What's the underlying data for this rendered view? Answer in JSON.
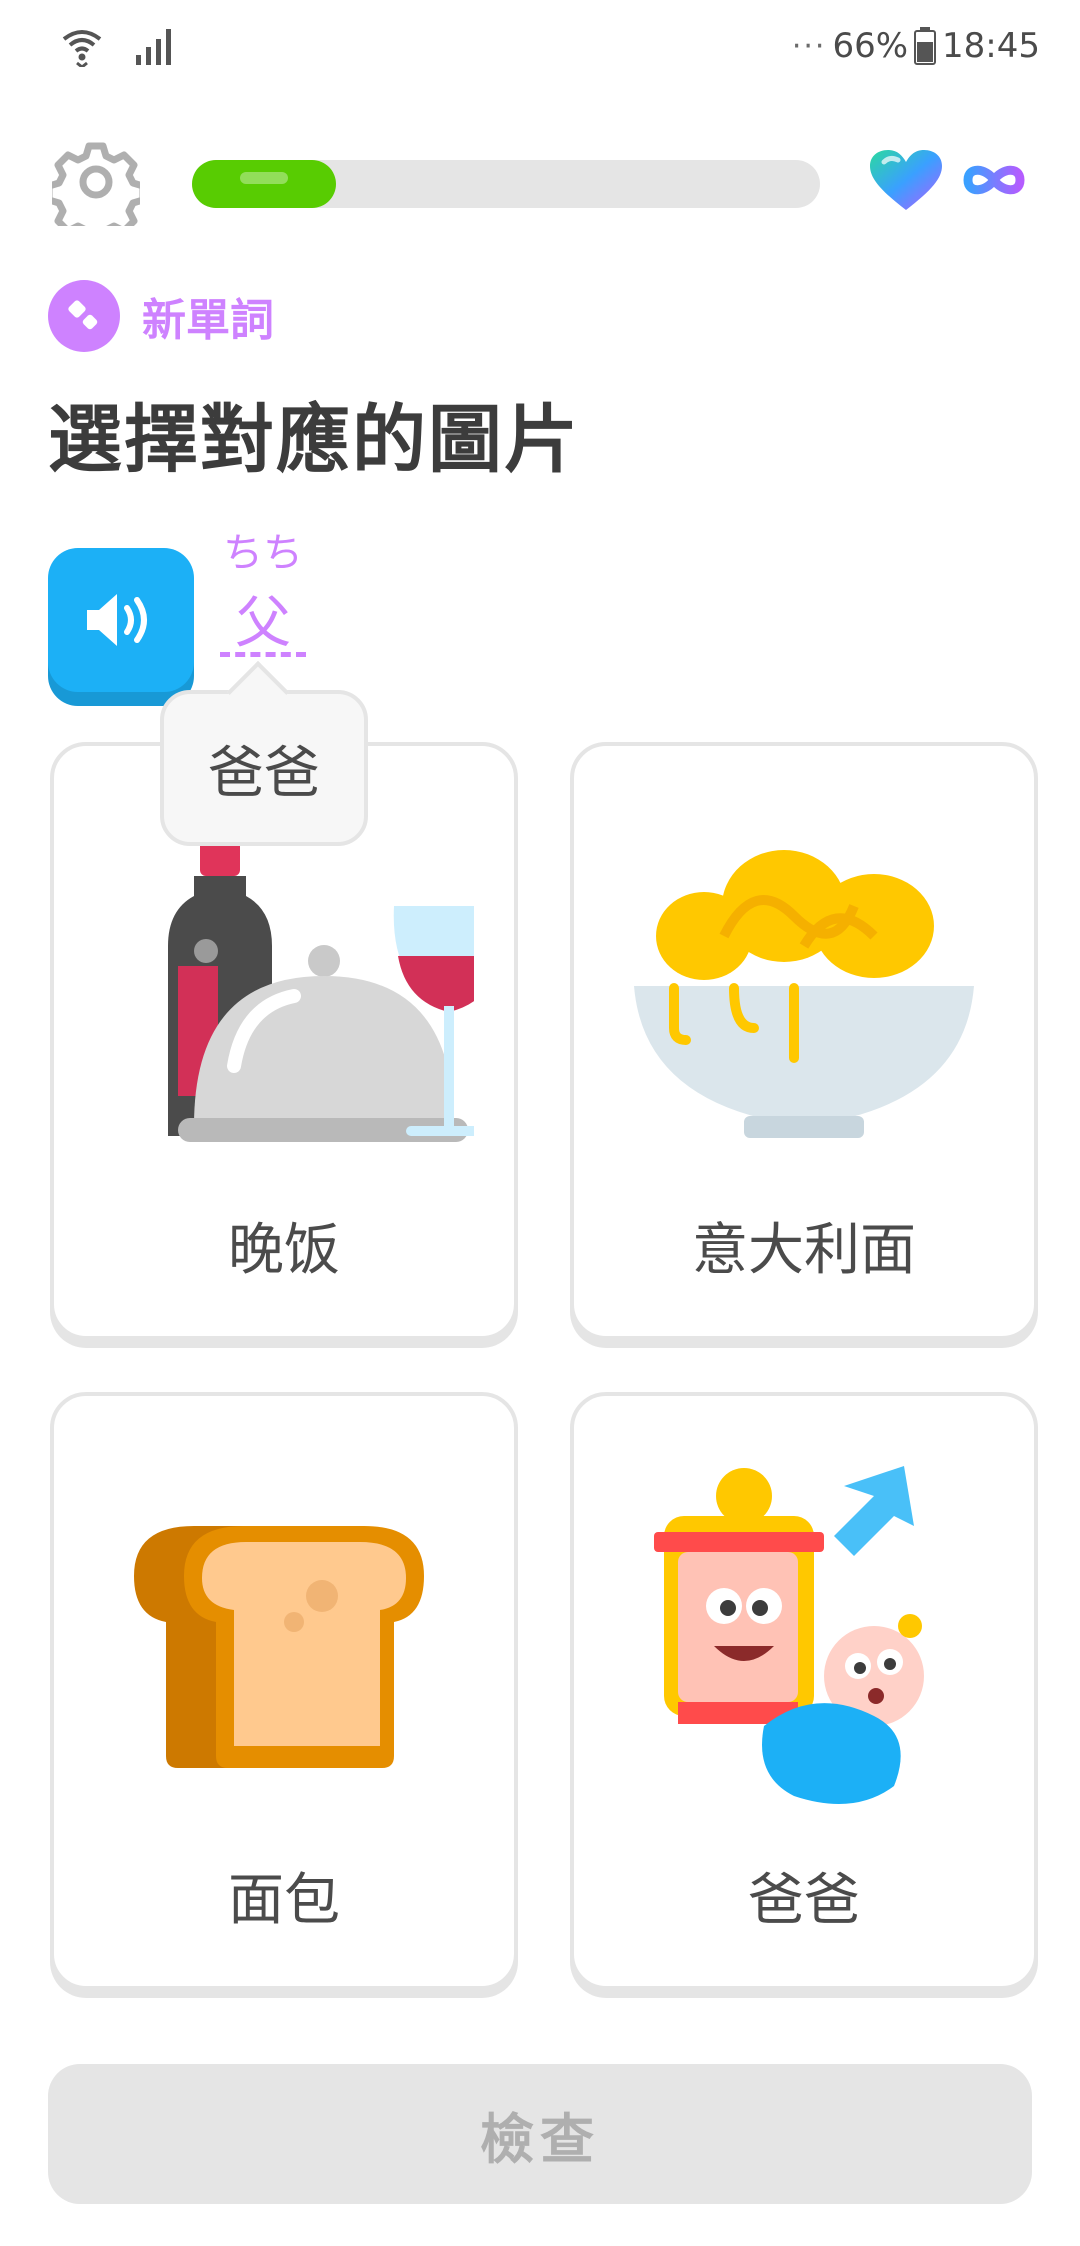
{
  "status_bar": {
    "battery_percent": "66%",
    "time": "18:45",
    "dots": "···"
  },
  "header": {
    "progress_fraction": 0.23
  },
  "challenge": {
    "badge_label": "新單詞",
    "title": "選擇對應的圖片",
    "word_furigana": "ちち",
    "word": "父",
    "tooltip": "爸爸"
  },
  "options": [
    {
      "label": "晚饭",
      "icon": "dinner-icon"
    },
    {
      "label": "意大利面",
      "icon": "pasta-icon"
    },
    {
      "label": "面包",
      "icon": "bread-icon"
    },
    {
      "label": "爸爸",
      "icon": "dad-icon"
    }
  ],
  "footer": {
    "check_label": "檢查"
  },
  "colors": {
    "accent_purple": "#ce82ff",
    "progress_green": "#58cc02",
    "speaker_blue": "#1cb0f6",
    "disabled_gray": "#e5e5e5"
  }
}
